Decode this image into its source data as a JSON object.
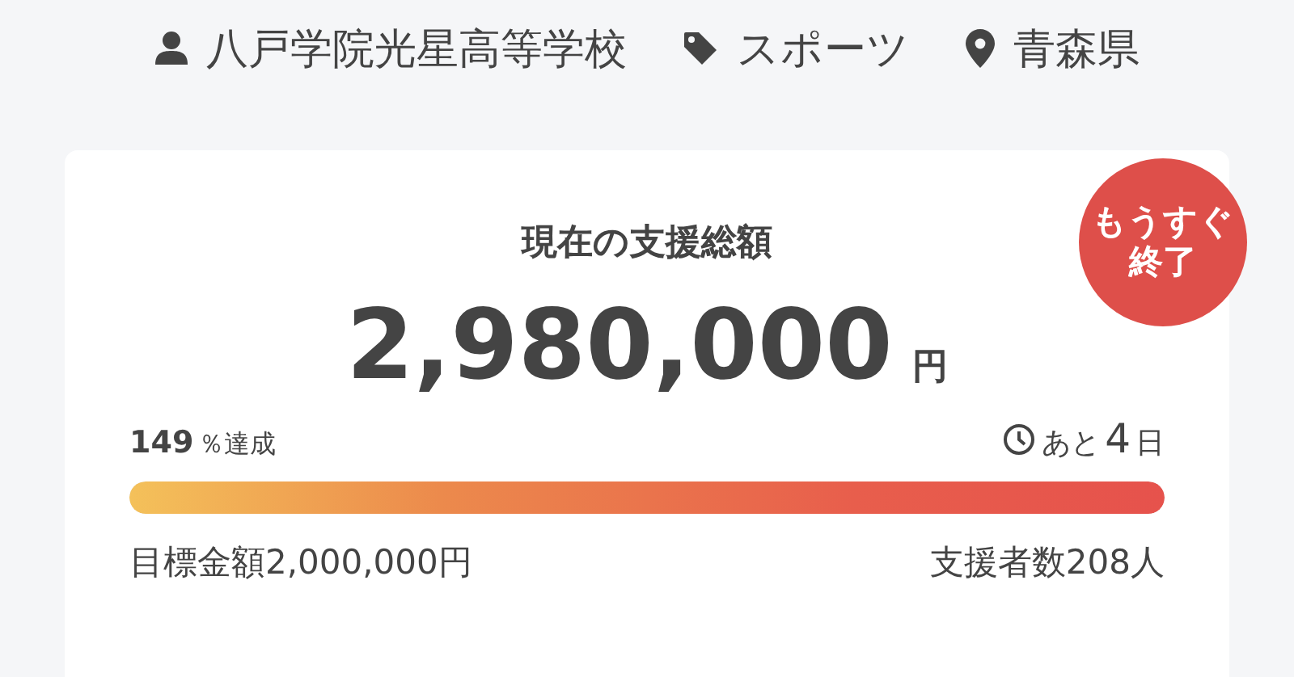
{
  "meta": [
    {
      "kind": "person",
      "text": "八戸学院光星高等学校"
    },
    {
      "kind": "tag",
      "text": "スポーツ"
    },
    {
      "kind": "location",
      "text": "青森県"
    }
  ],
  "card": {
    "badge": [
      "もうすぐ",
      "終了"
    ],
    "title": "現在の支援総額",
    "amount": "2,980,000",
    "unit": "円",
    "achievement": {
      "number": "149",
      "suffix": "％達成"
    },
    "remaining": {
      "prefix": "あと",
      "number": "4",
      "suffix": "日"
    },
    "progress": {
      "level": 1
    },
    "goal": "目標金額2,000,000円",
    "supporters": "支援者数208人"
  }
}
